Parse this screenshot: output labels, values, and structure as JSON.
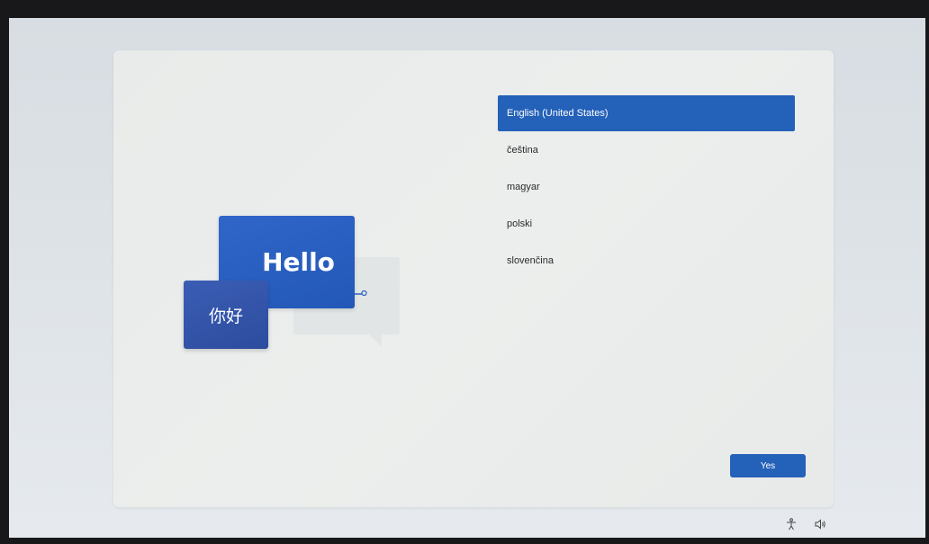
{
  "illustration": {
    "hello_text": "Hello",
    "nihao_text": "你好"
  },
  "languages": {
    "items": [
      {
        "label": "English (United States)",
        "selected": true
      },
      {
        "label": "čeština",
        "selected": false
      },
      {
        "label": "magyar",
        "selected": false
      },
      {
        "label": "polski",
        "selected": false
      },
      {
        "label": "slovenčina",
        "selected": false
      }
    ]
  },
  "footer": {
    "yes_label": "Yes"
  },
  "tray": {
    "icons": [
      "accessibility-icon",
      "volume-icon"
    ]
  },
  "colors": {
    "accent": "#2461b8",
    "hello_bubble": "#2a5fc0",
    "nihao_bubble": "#3356ab"
  }
}
